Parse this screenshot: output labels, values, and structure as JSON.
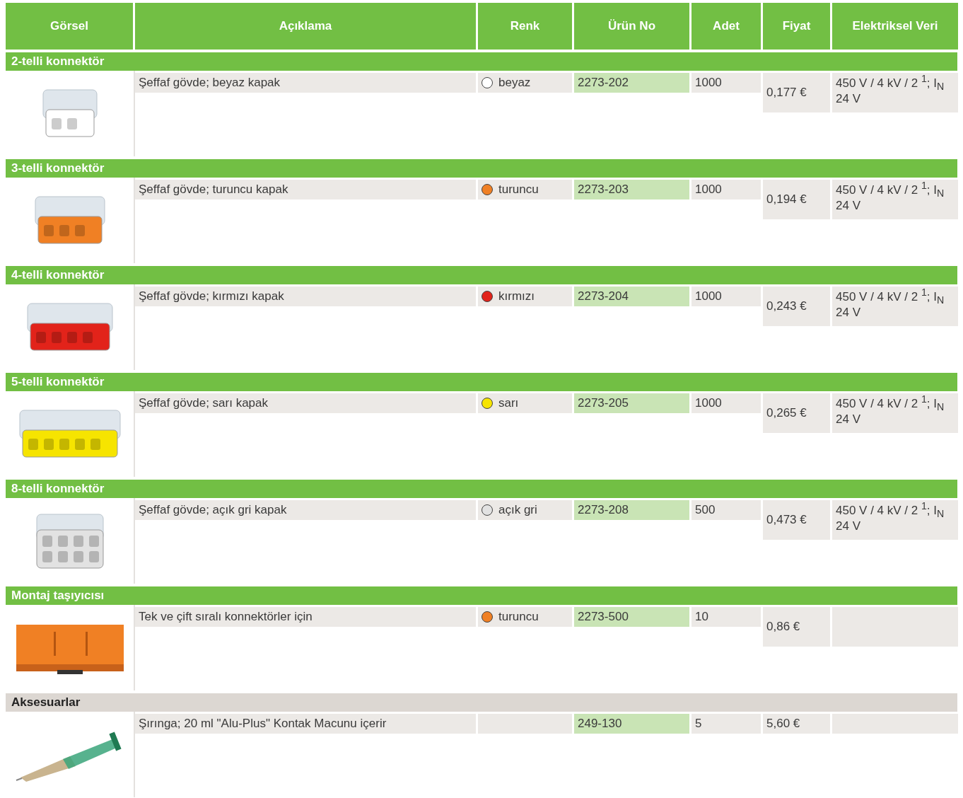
{
  "table": {
    "columns": [
      "Görsel",
      "Açıklama",
      "Renk",
      "Ürün No",
      "Adet",
      "Fiyat",
      "Elektriksel Veri"
    ],
    "sections": [
      {
        "title": "2-telli konnektör",
        "kind": "product",
        "rows": [
          {
            "kind": "connector",
            "description": "Şeffaf gövde; beyaz kapak",
            "color_name": "beyaz",
            "color": "#ffffff",
            "product_no": "2273-202",
            "quantity": "1000",
            "price": "0,177 €",
            "electrical": [
              "450 V / 4 kV / 2 $^{1}$; I$_{N}$",
              "24 V"
            ]
          }
        ]
      },
      {
        "title": "3-telli konnektör",
        "kind": "product",
        "rows": [
          {
            "kind": "connector",
            "description": "Şeffaf gövde; turuncu kapak",
            "color_name": "turuncu",
            "color": "#f08024",
            "product_no": "2273-203",
            "quantity": "1000",
            "price": "0,194 €",
            "electrical": [
              "450 V / 4 kV / 2 $^{1}$; I$_{N}$",
              "24 V"
            ]
          }
        ]
      },
      {
        "title": "4-telli konnektör",
        "kind": "product",
        "rows": [
          {
            "kind": "connector",
            "description": "Şeffaf gövde; kırmızı kapak",
            "color_name": "kırmızı",
            "color": "#e2231a",
            "product_no": "2273-204",
            "quantity": "1000",
            "price": "0,243 €",
            "electrical": [
              "450 V / 4 kV / 2 $^{1}$; I$_{N}$",
              "24 V"
            ]
          }
        ]
      },
      {
        "title": "5-telli konnektör",
        "kind": "product",
        "rows": [
          {
            "kind": "connector",
            "description": "Şeffaf gövde; sarı kapak",
            "color_name": "sarı",
            "color": "#f6e400",
            "product_no": "2273-205",
            "quantity": "1000",
            "price": "0,265 €",
            "electrical": [
              "450 V / 4 kV / 2 $^{1}$; I$_{N}$",
              "24 V"
            ]
          }
        ]
      },
      {
        "title": "8-telli konnektör",
        "kind": "product",
        "rows": [
          {
            "kind": "connector",
            "description": "Şeffaf gövde; açık gri kapak",
            "color_name": "açık gri",
            "color": "#e2e2e2",
            "product_no": "2273-208",
            "quantity": "500",
            "price": "0,473 €",
            "electrical": [
              "450 V / 4 kV / 2 $^{1}$; I$_{N}$",
              "24 V"
            ]
          }
        ]
      },
      {
        "title": "Montaj taşıyıcısı",
        "kind": "product",
        "rows": [
          {
            "kind": "carrier",
            "description": "Tek ve çift sıralı konnektörler için",
            "color_name": "turuncu",
            "color": "#f08024",
            "product_no": "2273-500",
            "quantity": "10",
            "price": "0,86 €"
          }
        ]
      },
      {
        "title": "Aksesuarlar",
        "kind": "accessory",
        "rows": [
          {
            "kind": "syringe",
            "description": "Şırınga; 20 ml \"Alu-Plus\" Kontak Macunu içerir",
            "product_no": "249-130",
            "quantity": "5",
            "price": "5,60 €"
          }
        ]
      }
    ]
  }
}
